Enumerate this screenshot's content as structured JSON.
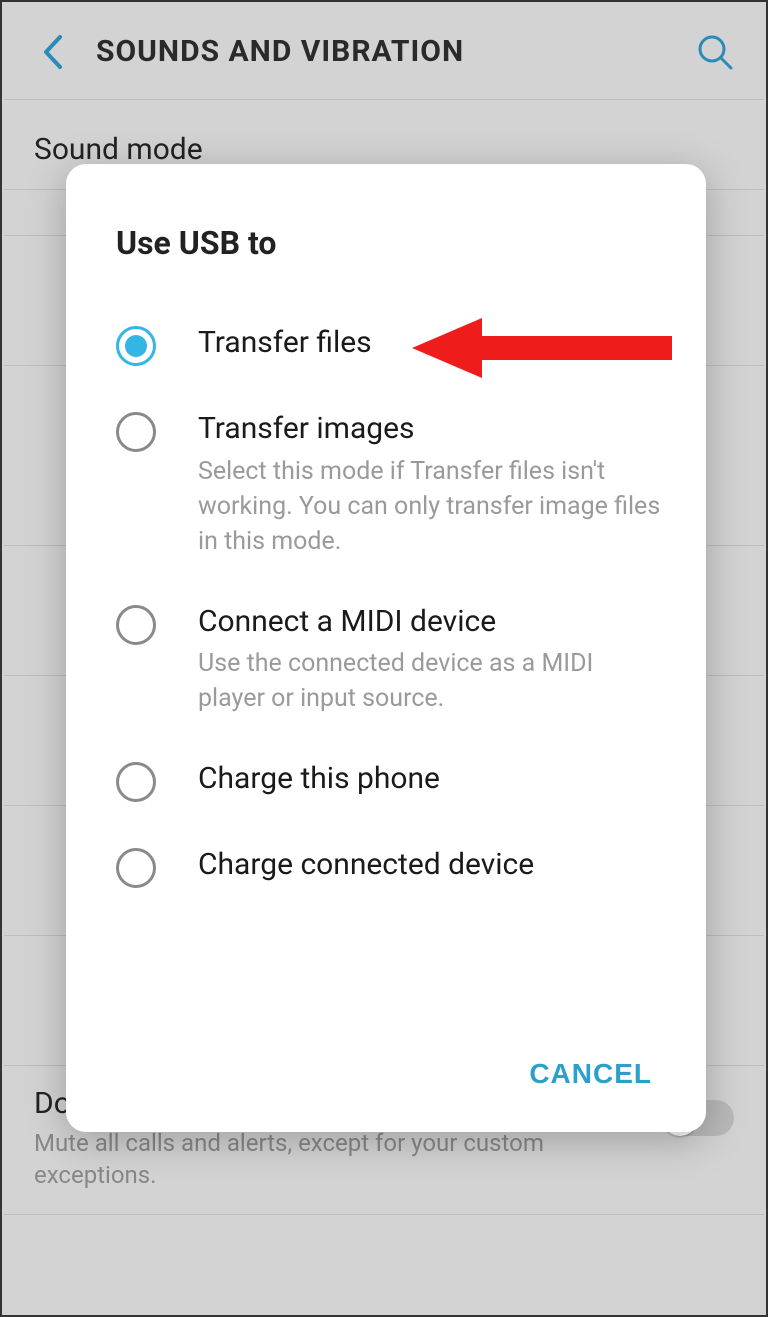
{
  "header": {
    "title": "SOUNDS AND VIBRATION"
  },
  "background": {
    "sound_mode_label": "Sound mode",
    "dnd_label": "Do not disturb",
    "dnd_desc": "Mute all calls and alerts, except for your custom exceptions."
  },
  "dialog": {
    "title": "Use USB to",
    "options": [
      {
        "label": "Transfer files",
        "desc": "",
        "selected": true
      },
      {
        "label": "Transfer images",
        "desc": "Select this mode if Transfer files isn't working. You can only transfer image files in this mode.",
        "selected": false
      },
      {
        "label": "Connect a MIDI device",
        "desc": "Use the connected device as a MIDI player or input source.",
        "selected": false
      },
      {
        "label": "Charge this phone",
        "desc": "",
        "selected": false
      },
      {
        "label": "Charge connected device",
        "desc": "",
        "selected": false
      }
    ],
    "cancel": "CANCEL"
  }
}
